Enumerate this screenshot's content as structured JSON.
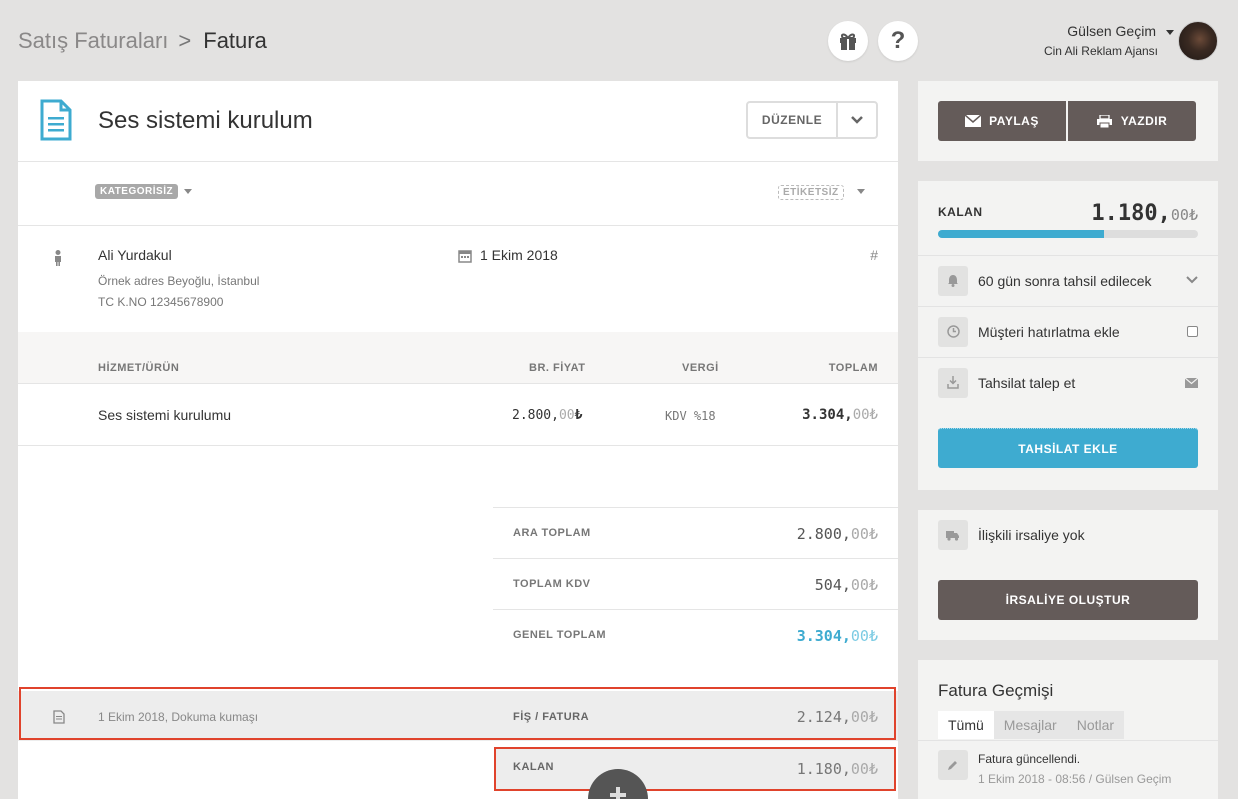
{
  "breadcrumb": {
    "parent": "Satış Faturaları",
    "separator": ">",
    "current": "Fatura"
  },
  "user": {
    "name": "Gülsen Geçim",
    "company": "Cin Ali Reklam Ajansı"
  },
  "invoice": {
    "title": "Ses sistemi kurulum",
    "edit_label": "DÜZENLE",
    "category": "KATEGORİSİZ",
    "tags": "ETİKETSİZ",
    "customer": {
      "name": "Ali Yurdakul",
      "address": "Örnek adres Beyoğlu, İstanbul",
      "tax_no": "TC K.NO 12345678900"
    },
    "date": "1 Ekim 2018",
    "number_symbol": "#",
    "columns": {
      "item": "HİZMET/ÜRÜN",
      "price": "BR. FİYAT",
      "tax": "VERGİ",
      "total": "TOPLAM"
    },
    "lines": [
      {
        "name": "Ses sistemi kurulumu",
        "price_int": "2.800,",
        "price_dec": "00",
        "price_cur": "₺",
        "tax": "KDV %18",
        "total_int": "3.304,",
        "total_dec": "00₺"
      }
    ],
    "summary": {
      "subtotal_label": "ARA TOPLAM",
      "subtotal_int": "2.800,",
      "subtotal_dec": "00₺",
      "vat_label": "TOPLAM KDV",
      "vat_int": "504,",
      "vat_dec": "00₺",
      "grand_label": "GENEL TOPLAM",
      "grand_int": "3.304,",
      "grand_dec": "00₺"
    },
    "payment": {
      "desc": "1 Ekim 2018, Dokuma kumaşı",
      "label": "FİŞ / FATURA",
      "amount_int": "2.124,",
      "amount_dec": "00₺"
    },
    "remaining": {
      "label": "KALAN",
      "amount_int": "1.180,",
      "amount_dec": "00₺"
    }
  },
  "sidebar": {
    "share_label": "PAYLAŞ",
    "print_label": "YAZDIR",
    "balance": {
      "label": "KALAN",
      "amount_int": "1.180,",
      "amount_dec": "00₺",
      "progress": 0.64
    },
    "due_text": "60 gün sonra tahsil edilecek",
    "reminder_text": "Müşteri hatırlatma ekle",
    "request_text": "Tahsilat talep et",
    "add_payment_label": "TAHSİLAT EKLE",
    "waybill_text": "İlişkili irsaliye yok",
    "create_waybill_label": "İRSALİYE OLUŞTUR",
    "history": {
      "title": "Fatura Geçmişi",
      "tabs": [
        "Tümü",
        "Mesajlar",
        "Notlar"
      ],
      "entry_title": "Fatura güncellendi.",
      "entry_meta": "1 Ekim 2018 - 08:56 / Gülsen Geçim"
    }
  },
  "colors": {
    "accent": "#3eabd0",
    "dark_button": "#645b59",
    "highlight": "#e0432c"
  }
}
